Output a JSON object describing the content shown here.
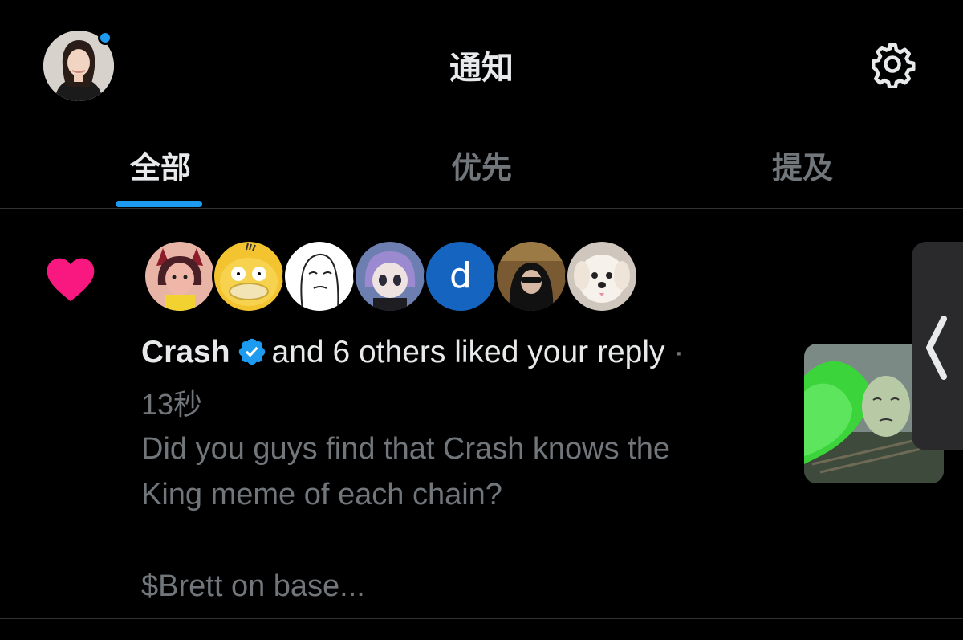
{
  "header": {
    "title": "通知",
    "avatar_icon": "user-avatar",
    "settings_icon": "gear-icon"
  },
  "tabs": [
    {
      "label": "全部",
      "active": true
    },
    {
      "label": "优先",
      "active": false
    },
    {
      "label": "提及",
      "active": false
    }
  ],
  "notification": {
    "type_icon": "heart-icon",
    "actor_name": "Crash",
    "action_text": "and 6 others liked your reply",
    "separator": "·",
    "time": "13秒",
    "body_lines": [
      "Did you guys find that Crash knows the",
      "King meme of each chain?",
      "",
      "$Brett on base..."
    ],
    "avatar_letter": "d"
  },
  "colors": {
    "accent": "#1d9bf0",
    "heart": "#f91880",
    "muted_text": "#71767b",
    "background": "#000000"
  }
}
